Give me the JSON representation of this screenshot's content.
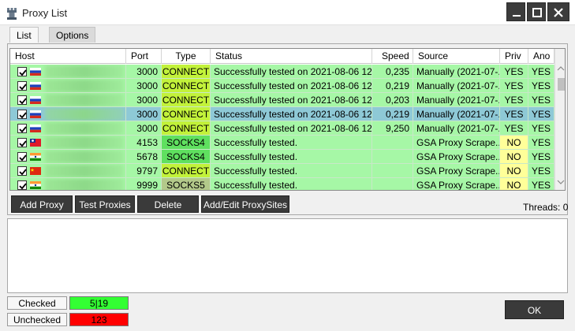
{
  "window": {
    "title": "Proxy List",
    "app_icon": "chess-rook-icon"
  },
  "tabs": [
    {
      "label": "List",
      "active": true
    },
    {
      "label": "Options",
      "active": false
    }
  ],
  "table": {
    "columns": [
      "Host",
      "Port",
      "Type",
      "Status",
      "Speed",
      "Source",
      "Priv",
      "Ano"
    ],
    "rows": [
      {
        "checked": true,
        "flag": "ru",
        "port": "3000",
        "type": "CONNECT",
        "status": "Successfully tested on 2021-08-06 12...",
        "speed": "0,235",
        "source": "Manually (2021-07-...",
        "priv": "YES",
        "ano": "YES",
        "selected": false
      },
      {
        "checked": true,
        "flag": "ru",
        "port": "3000",
        "type": "CONNECT",
        "status": "Successfully tested on 2021-08-06 12...",
        "speed": "0,219",
        "source": "Manually (2021-07-...",
        "priv": "YES",
        "ano": "YES",
        "selected": false
      },
      {
        "checked": true,
        "flag": "ru",
        "port": "3000",
        "type": "CONNECT",
        "status": "Successfully tested on 2021-08-06 12...",
        "speed": "0,203",
        "source": "Manually (2021-07-...",
        "priv": "YES",
        "ano": "YES",
        "selected": false
      },
      {
        "checked": true,
        "flag": "ru",
        "port": "3000",
        "type": "CONNECT",
        "status": "Successfully tested on 2021-08-06 12...",
        "speed": "0,219",
        "source": "Manually (2021-07-...",
        "priv": "YES",
        "ano": "YES",
        "selected": true
      },
      {
        "checked": true,
        "flag": "ru",
        "port": "3000",
        "type": "CONNECT",
        "status": "Successfully tested on 2021-08-06 12...",
        "speed": "9,250",
        "source": "Manually (2021-07-...",
        "priv": "YES",
        "ano": "YES",
        "selected": false
      },
      {
        "checked": true,
        "flag": "tw",
        "port": "4153",
        "type": "SOCKS4",
        "status": "Successfully tested.",
        "speed": "",
        "source": "GSA Proxy Scrape...",
        "priv": "NO",
        "ano": "YES",
        "selected": false
      },
      {
        "checked": true,
        "flag": "in",
        "port": "5678",
        "type": "SOCKS4",
        "status": "Successfully tested.",
        "speed": "",
        "source": "GSA Proxy Scrape...",
        "priv": "NO",
        "ano": "YES",
        "selected": false
      },
      {
        "checked": true,
        "flag": "cn",
        "port": "9797",
        "type": "CONNECT",
        "status": "Successfully tested.",
        "speed": "",
        "source": "GSA Proxy Scrape...",
        "priv": "NO",
        "ano": "YES",
        "selected": false
      },
      {
        "checked": true,
        "flag": "in",
        "port": "9999",
        "type": "SOCKS5",
        "status": "Successfully tested.",
        "speed": "",
        "source": "GSA Proxy Scrape...",
        "priv": "NO",
        "ano": "YES",
        "selected": false
      }
    ]
  },
  "buttons": {
    "add_proxy": "Add Proxy",
    "test_proxies": "Test Proxies",
    "delete": "Delete",
    "add_edit_sites": "Add/Edit ProxySites",
    "ok": "OK"
  },
  "threads_label": "Threads: 0",
  "stats": {
    "checked_label": "Checked",
    "checked_value": "5|19",
    "unchecked_label": "Unchecked",
    "unchecked_value": "123"
  },
  "colors": {
    "row_green": "#a6f7a6",
    "row_selected": "#8ec9d6",
    "connect": "#c2f23a",
    "socks4": "#5fe05f",
    "socks5": "#b3c98a",
    "no_yellow": "#ffff99",
    "checked_green": "#33ff33",
    "unchecked_red": "#ff0000"
  }
}
